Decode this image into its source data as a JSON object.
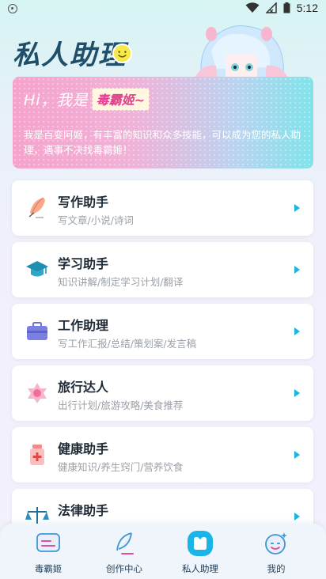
{
  "status_bar": {
    "time": "5:12"
  },
  "header": {
    "title": "私人助理"
  },
  "banner": {
    "greeting": "Hi，我是",
    "name": "毒霸姬~",
    "description": "我是百变阿姬，有丰富的知识和众多技能，可以成为您的私人助理，遇事不决找毒霸姬！"
  },
  "assistants": [
    {
      "title": "写作助手",
      "subtitle": "写文章/小说/诗词",
      "icon": "quill-icon"
    },
    {
      "title": "学习助手",
      "subtitle": "知识讲解/制定学习计划/翻译",
      "icon": "graduation-cap-icon"
    },
    {
      "title": "工作助理",
      "subtitle": "写工作汇报/总结/策划案/发言稿",
      "icon": "briefcase-icon"
    },
    {
      "title": "旅行达人",
      "subtitle": "出行计划/旅游攻略/美食推荐",
      "icon": "travel-star-icon"
    },
    {
      "title": "健康助手",
      "subtitle": "健康知识/养生窍门/营养饮食",
      "icon": "medicine-bottle-icon"
    },
    {
      "title": "法律助手",
      "subtitle": "",
      "icon": "scales-icon"
    }
  ],
  "bottom_nav": [
    {
      "label": "毒霸姬",
      "icon": "chat-icon",
      "active": false
    },
    {
      "label": "创作中心",
      "icon": "feather-pen-icon",
      "active": false
    },
    {
      "label": "私人助理",
      "icon": "assistant-icon",
      "active": true
    },
    {
      "label": "我的",
      "icon": "profile-face-icon",
      "active": false
    }
  ],
  "colors": {
    "accent": "#1ab6e0",
    "title": "#1f4f6a",
    "name_highlight": "#e1408c"
  }
}
